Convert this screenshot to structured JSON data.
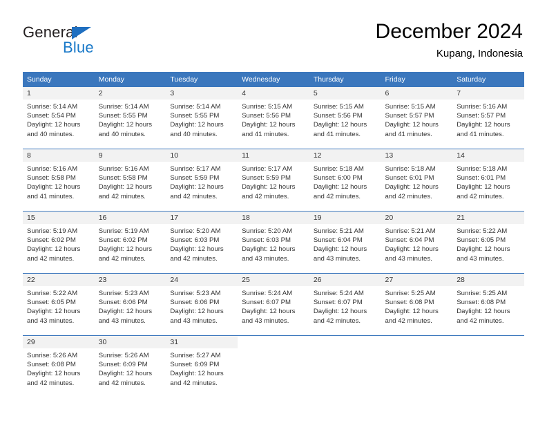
{
  "logo": {
    "word1": "General",
    "word2": "Blue",
    "triangle_color": "#1f6fc0",
    "word2_color": "#1878c8"
  },
  "header": {
    "title": "December 2024",
    "subtitle": "Kupang, Indonesia"
  },
  "colors": {
    "header_blue": "#3b77bd",
    "daynum_bg": "#f2f2f2",
    "text": "#333333"
  },
  "calendar": {
    "weekday_headers": [
      "Sunday",
      "Monday",
      "Tuesday",
      "Wednesday",
      "Thursday",
      "Friday",
      "Saturday"
    ],
    "weeks": [
      [
        {
          "day": "1",
          "sunrise": "Sunrise: 5:14 AM",
          "sunset": "Sunset: 5:54 PM",
          "daylight1": "Daylight: 12 hours",
          "daylight2": "and 40 minutes."
        },
        {
          "day": "2",
          "sunrise": "Sunrise: 5:14 AM",
          "sunset": "Sunset: 5:55 PM",
          "daylight1": "Daylight: 12 hours",
          "daylight2": "and 40 minutes."
        },
        {
          "day": "3",
          "sunrise": "Sunrise: 5:14 AM",
          "sunset": "Sunset: 5:55 PM",
          "daylight1": "Daylight: 12 hours",
          "daylight2": "and 40 minutes."
        },
        {
          "day": "4",
          "sunrise": "Sunrise: 5:15 AM",
          "sunset": "Sunset: 5:56 PM",
          "daylight1": "Daylight: 12 hours",
          "daylight2": "and 41 minutes."
        },
        {
          "day": "5",
          "sunrise": "Sunrise: 5:15 AM",
          "sunset": "Sunset: 5:56 PM",
          "daylight1": "Daylight: 12 hours",
          "daylight2": "and 41 minutes."
        },
        {
          "day": "6",
          "sunrise": "Sunrise: 5:15 AM",
          "sunset": "Sunset: 5:57 PM",
          "daylight1": "Daylight: 12 hours",
          "daylight2": "and 41 minutes."
        },
        {
          "day": "7",
          "sunrise": "Sunrise: 5:16 AM",
          "sunset": "Sunset: 5:57 PM",
          "daylight1": "Daylight: 12 hours",
          "daylight2": "and 41 minutes."
        }
      ],
      [
        {
          "day": "8",
          "sunrise": "Sunrise: 5:16 AM",
          "sunset": "Sunset: 5:58 PM",
          "daylight1": "Daylight: 12 hours",
          "daylight2": "and 41 minutes."
        },
        {
          "day": "9",
          "sunrise": "Sunrise: 5:16 AM",
          "sunset": "Sunset: 5:58 PM",
          "daylight1": "Daylight: 12 hours",
          "daylight2": "and 42 minutes."
        },
        {
          "day": "10",
          "sunrise": "Sunrise: 5:17 AM",
          "sunset": "Sunset: 5:59 PM",
          "daylight1": "Daylight: 12 hours",
          "daylight2": "and 42 minutes."
        },
        {
          "day": "11",
          "sunrise": "Sunrise: 5:17 AM",
          "sunset": "Sunset: 5:59 PM",
          "daylight1": "Daylight: 12 hours",
          "daylight2": "and 42 minutes."
        },
        {
          "day": "12",
          "sunrise": "Sunrise: 5:18 AM",
          "sunset": "Sunset: 6:00 PM",
          "daylight1": "Daylight: 12 hours",
          "daylight2": "and 42 minutes."
        },
        {
          "day": "13",
          "sunrise": "Sunrise: 5:18 AM",
          "sunset": "Sunset: 6:01 PM",
          "daylight1": "Daylight: 12 hours",
          "daylight2": "and 42 minutes."
        },
        {
          "day": "14",
          "sunrise": "Sunrise: 5:18 AM",
          "sunset": "Sunset: 6:01 PM",
          "daylight1": "Daylight: 12 hours",
          "daylight2": "and 42 minutes."
        }
      ],
      [
        {
          "day": "15",
          "sunrise": "Sunrise: 5:19 AM",
          "sunset": "Sunset: 6:02 PM",
          "daylight1": "Daylight: 12 hours",
          "daylight2": "and 42 minutes."
        },
        {
          "day": "16",
          "sunrise": "Sunrise: 5:19 AM",
          "sunset": "Sunset: 6:02 PM",
          "daylight1": "Daylight: 12 hours",
          "daylight2": "and 42 minutes."
        },
        {
          "day": "17",
          "sunrise": "Sunrise: 5:20 AM",
          "sunset": "Sunset: 6:03 PM",
          "daylight1": "Daylight: 12 hours",
          "daylight2": "and 42 minutes."
        },
        {
          "day": "18",
          "sunrise": "Sunrise: 5:20 AM",
          "sunset": "Sunset: 6:03 PM",
          "daylight1": "Daylight: 12 hours",
          "daylight2": "and 43 minutes."
        },
        {
          "day": "19",
          "sunrise": "Sunrise: 5:21 AM",
          "sunset": "Sunset: 6:04 PM",
          "daylight1": "Daylight: 12 hours",
          "daylight2": "and 43 minutes."
        },
        {
          "day": "20",
          "sunrise": "Sunrise: 5:21 AM",
          "sunset": "Sunset: 6:04 PM",
          "daylight1": "Daylight: 12 hours",
          "daylight2": "and 43 minutes."
        },
        {
          "day": "21",
          "sunrise": "Sunrise: 5:22 AM",
          "sunset": "Sunset: 6:05 PM",
          "daylight1": "Daylight: 12 hours",
          "daylight2": "and 43 minutes."
        }
      ],
      [
        {
          "day": "22",
          "sunrise": "Sunrise: 5:22 AM",
          "sunset": "Sunset: 6:05 PM",
          "daylight1": "Daylight: 12 hours",
          "daylight2": "and 43 minutes."
        },
        {
          "day": "23",
          "sunrise": "Sunrise: 5:23 AM",
          "sunset": "Sunset: 6:06 PM",
          "daylight1": "Daylight: 12 hours",
          "daylight2": "and 43 minutes."
        },
        {
          "day": "24",
          "sunrise": "Sunrise: 5:23 AM",
          "sunset": "Sunset: 6:06 PM",
          "daylight1": "Daylight: 12 hours",
          "daylight2": "and 43 minutes."
        },
        {
          "day": "25",
          "sunrise": "Sunrise: 5:24 AM",
          "sunset": "Sunset: 6:07 PM",
          "daylight1": "Daylight: 12 hours",
          "daylight2": "and 43 minutes."
        },
        {
          "day": "26",
          "sunrise": "Sunrise: 5:24 AM",
          "sunset": "Sunset: 6:07 PM",
          "daylight1": "Daylight: 12 hours",
          "daylight2": "and 42 minutes."
        },
        {
          "day": "27",
          "sunrise": "Sunrise: 5:25 AM",
          "sunset": "Sunset: 6:08 PM",
          "daylight1": "Daylight: 12 hours",
          "daylight2": "and 42 minutes."
        },
        {
          "day": "28",
          "sunrise": "Sunrise: 5:25 AM",
          "sunset": "Sunset: 6:08 PM",
          "daylight1": "Daylight: 12 hours",
          "daylight2": "and 42 minutes."
        }
      ],
      [
        {
          "day": "29",
          "sunrise": "Sunrise: 5:26 AM",
          "sunset": "Sunset: 6:08 PM",
          "daylight1": "Daylight: 12 hours",
          "daylight2": "and 42 minutes."
        },
        {
          "day": "30",
          "sunrise": "Sunrise: 5:26 AM",
          "sunset": "Sunset: 6:09 PM",
          "daylight1": "Daylight: 12 hours",
          "daylight2": "and 42 minutes."
        },
        {
          "day": "31",
          "sunrise": "Sunrise: 5:27 AM",
          "sunset": "Sunset: 6:09 PM",
          "daylight1": "Daylight: 12 hours",
          "daylight2": "and 42 minutes."
        },
        {
          "day": "",
          "sunrise": "",
          "sunset": "",
          "daylight1": "",
          "daylight2": ""
        },
        {
          "day": "",
          "sunrise": "",
          "sunset": "",
          "daylight1": "",
          "daylight2": ""
        },
        {
          "day": "",
          "sunrise": "",
          "sunset": "",
          "daylight1": "",
          "daylight2": ""
        },
        {
          "day": "",
          "sunrise": "",
          "sunset": "",
          "daylight1": "",
          "daylight2": ""
        }
      ]
    ]
  }
}
